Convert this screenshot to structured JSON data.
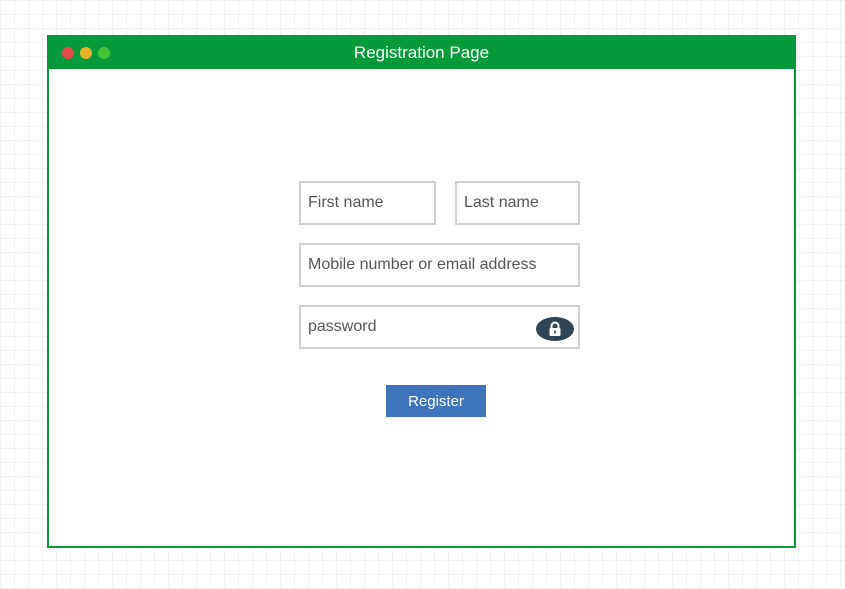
{
  "window": {
    "title": "Registration Page"
  },
  "form": {
    "first_name": {
      "value": "",
      "placeholder": "First name"
    },
    "last_name": {
      "value": "",
      "placeholder": "Last name"
    },
    "contact": {
      "value": "",
      "placeholder": "Mobile number or email address"
    },
    "password": {
      "value": "",
      "placeholder": "password",
      "icon": "lock-icon"
    },
    "register_label": "Register"
  },
  "colors": {
    "titlebar": "#079a3a",
    "window_border": "#079a3a",
    "dot_close": "#e24b4b",
    "dot_minimize": "#e7b22a",
    "dot_maximize": "#45c431",
    "lock_badge": "#2e4657",
    "register_button": "#3d74bc",
    "field_border": "#cfcfcf"
  }
}
